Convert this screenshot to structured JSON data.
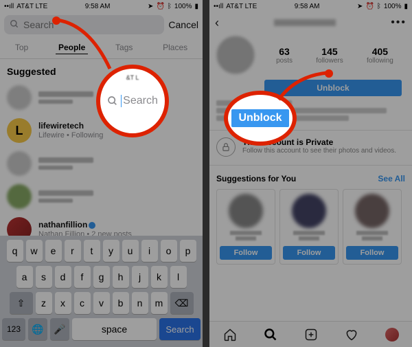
{
  "status": {
    "carrier": "AT&T  LTE",
    "time": "9:58 AM",
    "alarm_icon": "⏰",
    "bt_icon": "ᛒ",
    "battery": "100%"
  },
  "left": {
    "search_placeholder": "Search",
    "cancel": "Cancel",
    "tabs": {
      "top": "Top",
      "people": "People",
      "tags": "Tags",
      "places": "Places"
    },
    "suggested_heading": "Suggested",
    "lifewire": {
      "user": "lifewiretech",
      "sub": "Lifewire • Following"
    },
    "nathan": {
      "user": "nathanfillion",
      "sub": "Nathan Fillion • 2 new posts"
    },
    "keyboard": {
      "r1": [
        "q",
        "w",
        "e",
        "r",
        "t",
        "y",
        "u",
        "i",
        "o",
        "p"
      ],
      "r2": [
        "a",
        "s",
        "d",
        "f",
        "g",
        "h",
        "j",
        "k",
        "l"
      ],
      "r3": [
        "z",
        "x",
        "c",
        "v",
        "b",
        "n",
        "m"
      ],
      "num": "123",
      "space": "space",
      "search": "Search"
    }
  },
  "right": {
    "stats": {
      "posts_n": "63",
      "posts_l": "posts",
      "followers_n": "145",
      "followers_l": "followers",
      "following_n": "405",
      "following_l": "following"
    },
    "unblock": "Unblock",
    "private_title": "This Account is Private",
    "private_sub": "Follow this account to see their photos and videos.",
    "sfy": "Suggestions for You",
    "see_all": "See All",
    "follow": "Follow"
  },
  "bubble": {
    "mini": "&T  L",
    "search": "Search",
    "unblock": "Unblock"
  }
}
